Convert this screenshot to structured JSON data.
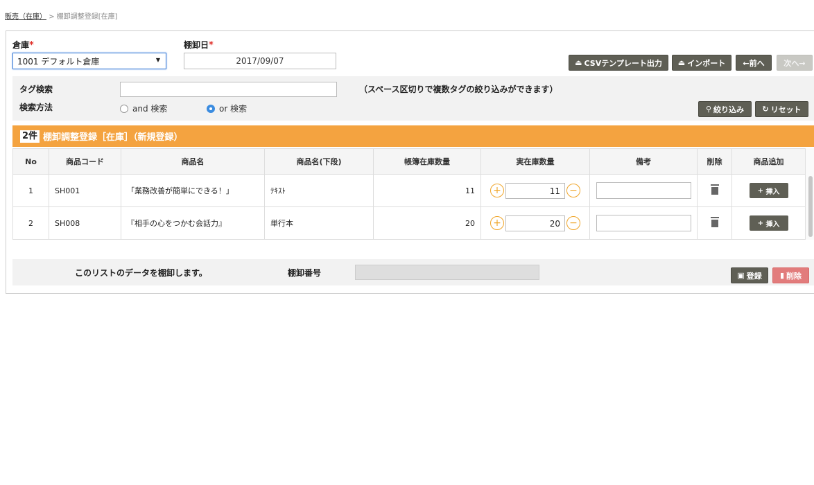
{
  "breadcrumb": {
    "link": "販売（在庫）",
    "sep": ">",
    "current": "棚卸調整登録[在庫]"
  },
  "form": {
    "warehouse_label": "倉庫",
    "warehouse_value": "1001 デフォルト倉庫",
    "date_label": "棚卸日",
    "date_value": "2017/09/07",
    "required_mark": "*"
  },
  "toolbar": {
    "csv_label": "CSVテンプレート出力",
    "import_label": "インポート",
    "prev_label": "←前へ",
    "next_label": "次へ→"
  },
  "search": {
    "tag_label": "タグ検索",
    "tag_value": "",
    "hint": "（スペース区切りで複数タグの絞り込みができます）",
    "method_label": "検索方法",
    "opt_and": "and 検索",
    "opt_or": "or 検索",
    "filter_label": "絞り込み",
    "reset_label": "リセット"
  },
  "header_bar": {
    "count": "2件",
    "title": "棚卸調整登録［在庫］（新規登録）"
  },
  "table": {
    "headers": [
      "No",
      "商品コード",
      "商品名",
      "商品名(下段)",
      "帳簿在庫数量",
      "実在庫数量",
      "備考",
      "削除",
      "商品追加"
    ],
    "rows": [
      {
        "no": "1",
        "code": "SH001",
        "name": "「業務改善が簡単にできる！」",
        "name2": "ﾃｷｽﾄ",
        "book": "11",
        "actual": "11",
        "memo": ""
      },
      {
        "no": "2",
        "code": "SH008",
        "name": "『相手の心をつかむ会話力』",
        "name2": "単行本",
        "book": "20",
        "actual": "20",
        "memo": ""
      }
    ],
    "insert_label": "挿入"
  },
  "footer": {
    "message": "このリストのデータを棚卸します。",
    "number_label": "棚卸番号",
    "number_value": "",
    "register_label": "登録",
    "delete_label": "削除"
  }
}
